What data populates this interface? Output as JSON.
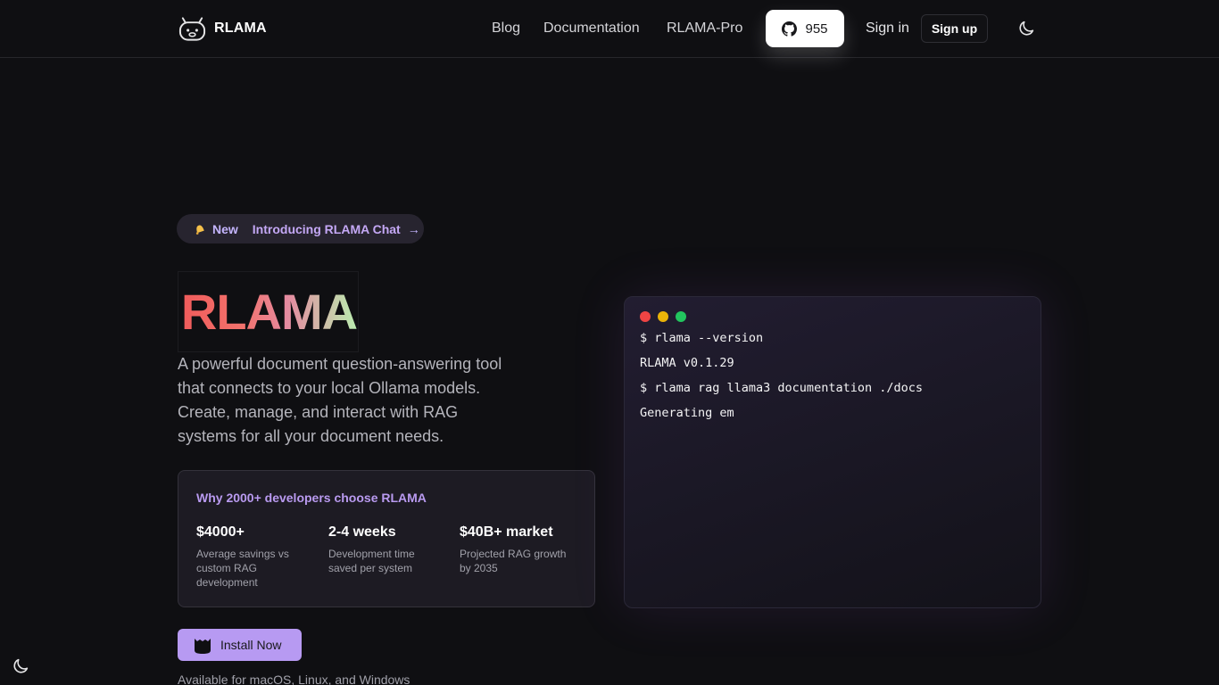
{
  "header": {
    "brand": "RLAMA",
    "nav": [
      "Blog",
      "Documentation",
      "RLAMA-Pro"
    ],
    "github_stars": "955",
    "signin": "Sign in",
    "signup": "Sign up",
    "theme_icon": "moon-icon"
  },
  "badge": {
    "icon": "bell-icon",
    "new_label": "New",
    "text": "Introducing RLAMA Chat",
    "arrow": "→"
  },
  "hero": {
    "title": "RLAMA",
    "description": "A powerful document question-answering tool that connects to your local Ollama models. Create, manage, and interact with RAG systems for all your document needs."
  },
  "stats": {
    "heading": "Why 2000+ developers choose RLAMA",
    "items": [
      {
        "value": "$4000+",
        "label": "Average savings vs custom RAG development"
      },
      {
        "value": "2-4 weeks",
        "label": "Development time saved per system"
      },
      {
        "value": "$40B+ market",
        "label": "Projected RAG growth by 2035"
      }
    ]
  },
  "install": {
    "label": "Install Now",
    "platforms": "Available for macOS, Linux, and Windows"
  },
  "terminal": {
    "lines": [
      "$ rlama --version",
      "RLAMA v0.1.29",
      "$ rlama rag llama3 documentation ./docs",
      "Generating em"
    ]
  },
  "colors": {
    "accent": "#b79af2",
    "background": "#0f0f12",
    "dot_red": "#ef4444",
    "dot_yellow": "#eab308",
    "dot_green": "#22c55e"
  }
}
